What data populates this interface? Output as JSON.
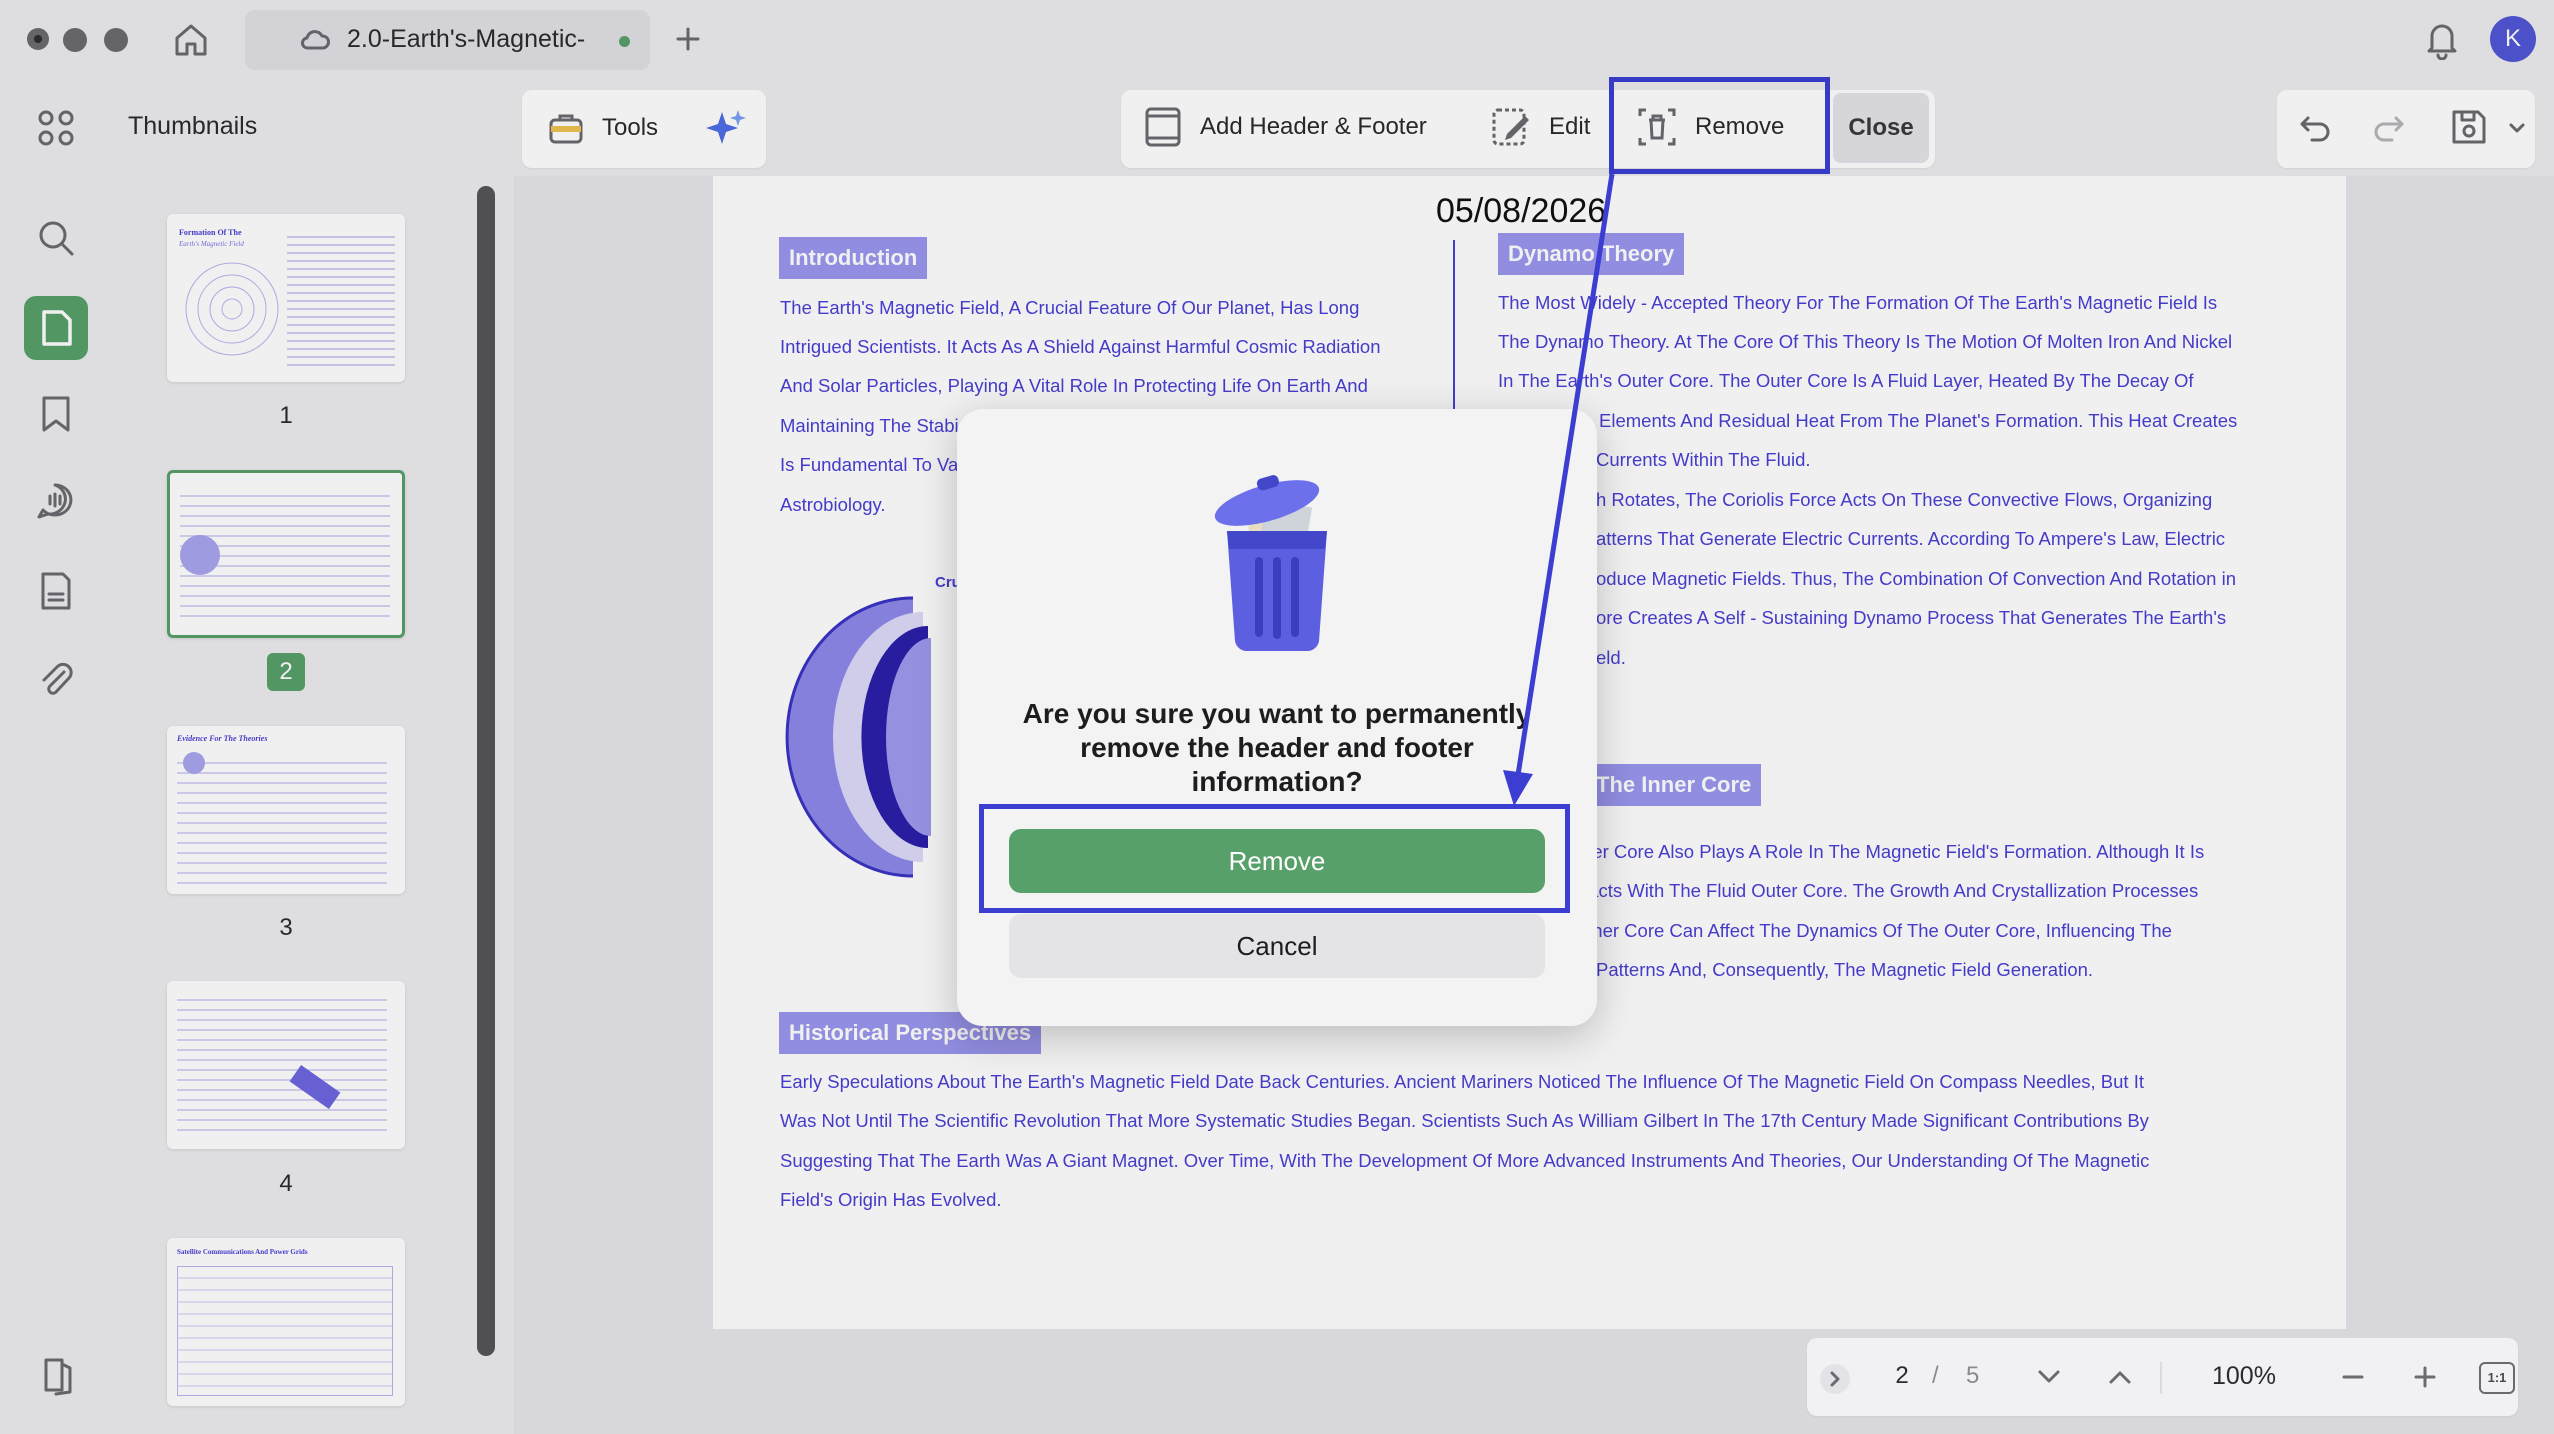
{
  "tab": {
    "title": "2.0-Earth's-Magnetic-"
  },
  "user": {
    "avatar_letter": "K"
  },
  "sidebar": {
    "title": "Thumbnails",
    "pages": [
      "1",
      "2",
      "3",
      "4"
    ],
    "selected": "2",
    "thumb_titles": [
      "Formation Of The",
      "Earth's Magnetic Field",
      "Evidence For The Theories",
      "Satellite Communications And Power Grids"
    ]
  },
  "toolbar": {
    "tools_label": "Tools",
    "add_hf_label": "Add Header & Footer",
    "edit_label": "Edit",
    "remove_label": "Remove",
    "close_label": "Close"
  },
  "document": {
    "header_date": "05/08/2026",
    "intro": {
      "heading": "Introduction",
      "lines": [
        "The Earth's Magnetic Field, A Crucial Feature Of Our Planet, Has Long",
        "Intrigued Scientists. It Acts As A Shield Against Harmful Cosmic Radiation",
        "And Solar Particles, Playing A Vital Role In Protecting Life On Earth And",
        "Maintaining The Stabi",
        "Is Fundamental To Va",
        "Astrobiology."
      ]
    },
    "dynamo": {
      "heading": "Dynamo Theory",
      "lines": [
        "The Most Widely - Accepted Theory For The Formation Of The Earth's Magnetic Field Is",
        "The Dynamo Theory. At The Core Of This Theory Is The Motion Of Molten Iron And Nickel",
        "In The Earth's Outer Core. The Outer Core Is A Fluid Layer, Heated By The Decay Of",
        "Elements And Residual Heat From The Planet's Formation. This Heat Creates",
        "Currents Within The Fluid.",
        "h Rotates, The Coriolis Force Acts On These Convective Flows, Organizing",
        "atterns That Generate Electric Currents. According To Ampere's Law, Electric",
        "oduce Magnetic Fields. Thus, The Combination Of Convection And Rotation in",
        "ore Creates A Self - Sustaining Dynamo Process That Generates The Earth's",
        "eld."
      ]
    },
    "inner": {
      "heading": "The Inner Core",
      "lines": [
        "ner Core Also Plays A Role In The Magnetic Field's Formation. Although It Is",
        "racts With The Fluid Outer Core. The Growth And Crystallization Processes",
        "nner Core Can Affect The Dynamics Of The Outer Core, Influencing The",
        "Patterns And, Consequently, The Magnetic Field Generation."
      ]
    },
    "diagram_label": "Cru",
    "historical": {
      "heading": "Historical Perspectives",
      "lines": [
        "Early Speculations About The Earth's Magnetic Field Date Back Centuries. Ancient Mariners Noticed The Influence Of The Magnetic Field On Compass Needles, But It",
        "Was Not Until The Scientific Revolution That More Systematic Studies Began. Scientists Such As William Gilbert In The 17th Century Made Significant Contributions By",
        "Suggesting That The Earth Was A Giant Magnet. Over Time, With The Development Of More Advanced Instruments And Theories, Our Understanding Of The Magnetic",
        "Field's Origin Has Evolved."
      ]
    }
  },
  "dialog": {
    "message": "Are you sure you want to permanently remove the header and footer information?",
    "remove_label": "Remove",
    "cancel_label": "Cancel"
  },
  "pager": {
    "current": "2",
    "separator": "/",
    "total": "5",
    "zoom": "100%",
    "fit_label": "1:1"
  },
  "colors": {
    "accent_green": "#58a06a",
    "annotation_blue": "#3b3ed1",
    "doc_text": "#4a3fd6"
  }
}
